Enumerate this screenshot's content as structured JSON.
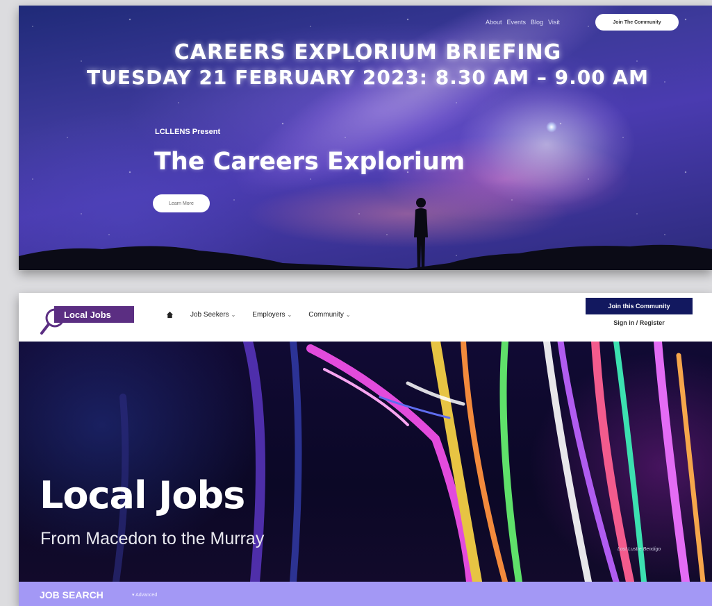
{
  "banner": {
    "nav": [
      "About",
      "Events",
      "Blog",
      "Visit"
    ],
    "join_button": "Join The Community",
    "briefing_line1": "CAREERS EXPLORIUM BRIEFING",
    "briefing_line2": "TUESDAY 21 FEBRUARY 2023: 8.30 AM – 9.00 AM",
    "presenter": "LCLLENS Present",
    "title": "The Careers Explorium",
    "learn_more": "Learn More"
  },
  "site": {
    "logo_text": "Local Jobs",
    "nav": [
      {
        "label": "Job Seekers"
      },
      {
        "label": "Employers"
      },
      {
        "label": "Community"
      }
    ],
    "join_button": "Join this Community",
    "signin": "Sign in / Register",
    "hero_title": "Local Jobs",
    "hero_subtitle": "From Macedon to the Murray",
    "photo_credit": "Lost Lustre Bendigo",
    "search_label": "JOB SEARCH",
    "search_advanced": "▾ Advanced"
  },
  "colors": {
    "logo_purple": "#5b2e82",
    "join_navy": "#12185f",
    "search_bar": "#a398f5"
  }
}
